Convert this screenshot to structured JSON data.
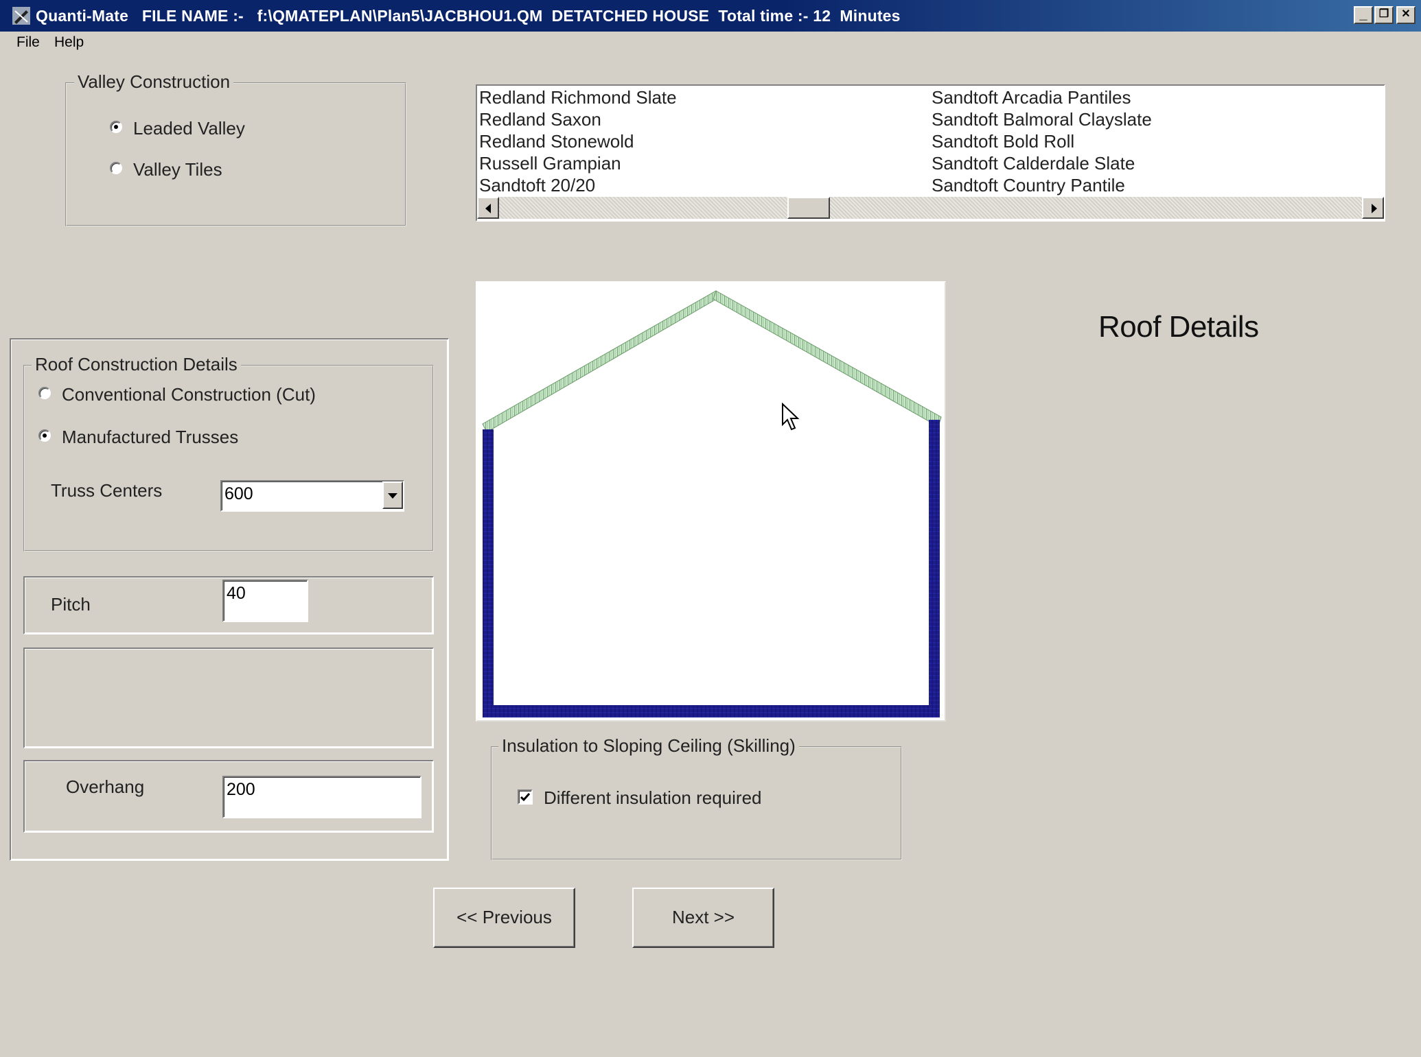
{
  "window": {
    "app_name": "Quanti-Mate",
    "title_text": "Quanti-Mate   FILE NAME :-   f:\\QMATEPLAN\\Plan5\\JACBHOU1.QM  DETATCHED HOUSE  Total time :- 12  Minutes",
    "minimize_label": "_",
    "restore_label": "❐",
    "close_label": "✕"
  },
  "menu": {
    "file": "File",
    "help": "Help"
  },
  "valley": {
    "legend": "Valley Construction",
    "options": [
      {
        "label": "Leaded Valley",
        "selected": true
      },
      {
        "label": "Valley Tiles",
        "selected": false
      }
    ]
  },
  "tile_list": {
    "column1": [
      "Redland Richmond Slate",
      "Redland Saxon",
      "Redland Stonewold",
      "Russell Grampian",
      "Sandtoft 20/20"
    ],
    "column2": [
      "Sandtoft Arcadia Pantiles",
      "Sandtoft Balmoral Clayslate",
      "Sandtoft Bold Roll",
      "Sandtoft Calderdale Slate",
      "Sandtoft Country Pantile"
    ],
    "scroll_left_icon": "arrow-left-icon",
    "scroll_right_icon": "arrow-right-icon"
  },
  "heading": "Roof Details",
  "roof": {
    "legend": "Roof Construction Details",
    "options": [
      {
        "label": "Conventional Construction (Cut)",
        "selected": false
      },
      {
        "label": "Manufactured Trusses",
        "selected": true
      }
    ],
    "truss_centers_label": "Truss Centers",
    "truss_centers_value": "600",
    "pitch_label": "Pitch",
    "pitch_value": "40",
    "overhang_label": "Overhang",
    "overhang_value": "200"
  },
  "insulation": {
    "legend": "Insulation to Sloping Ceiling (Skilling)",
    "checkbox_label": "Different insulation required",
    "checked": true
  },
  "buttons": {
    "previous": "<< Previous",
    "next": "Next >>"
  },
  "colors": {
    "roof_tiles": "#a9d4a9",
    "walls": "#1c1c8a",
    "titlebar": "#0a246a",
    "window_bg": "#d4d0c8"
  }
}
